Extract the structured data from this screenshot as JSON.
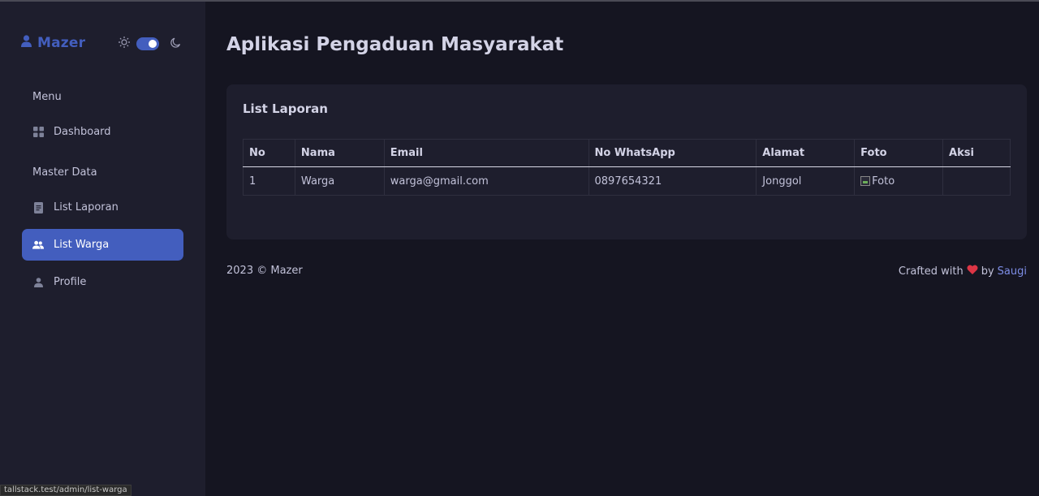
{
  "brand": {
    "name": "Mazer"
  },
  "sidebar": {
    "sections": [
      {
        "title": "Menu"
      },
      {
        "title": "Master Data"
      }
    ],
    "items": [
      {
        "label": "Dashboard",
        "icon": "grid-icon",
        "active": false
      },
      {
        "label": "List Laporan",
        "icon": "document-icon",
        "active": false
      },
      {
        "label": "List Warga",
        "icon": "people-icon",
        "active": true
      },
      {
        "label": "Profile",
        "icon": "person-icon",
        "active": false
      }
    ]
  },
  "header": {
    "title": "Aplikasi Pengaduan Masyarakat"
  },
  "card": {
    "title": "List Laporan",
    "table": {
      "columns": [
        "No",
        "Nama",
        "Email",
        "No WhatsApp",
        "Alamat",
        "Foto",
        "Aksi"
      ],
      "rows": [
        {
          "no": "1",
          "nama": "Warga",
          "email": "warga@gmail.com",
          "whatsapp": "0897654321",
          "alamat": "Jonggol",
          "foto_alt": "Foto",
          "aksi": ""
        }
      ]
    }
  },
  "footer": {
    "left": "2023 © Mazer",
    "crafted": "Crafted with",
    "by": "by",
    "author": "Saugi"
  },
  "status_bar": {
    "url": "tallstack.test/admin/list-warga"
  },
  "colors": {
    "accent": "#435ebe",
    "background": "#151521",
    "sidebar": "#1e1e2d",
    "heart": "#dc3545"
  }
}
